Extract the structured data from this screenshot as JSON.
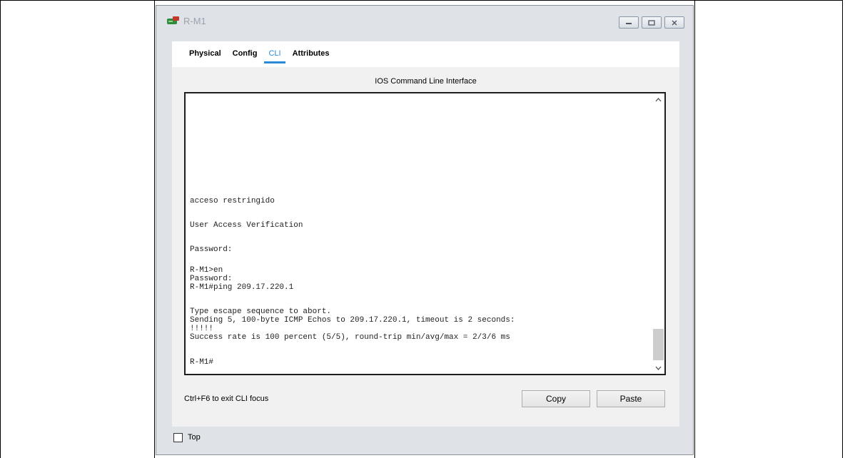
{
  "window": {
    "title": "R-M1",
    "icon": "router-icon",
    "controls": [
      "minimize-icon",
      "maximize-icon",
      "close-icon"
    ]
  },
  "tabs": [
    {
      "label": "Physical",
      "active": false
    },
    {
      "label": "Config",
      "active": false
    },
    {
      "label": "CLI",
      "active": true
    },
    {
      "label": "Attributes",
      "active": false
    }
  ],
  "cli": {
    "header": "IOS Command Line Interface",
    "lines": [
      "acceso restringido",
      "User Access Verification",
      "Password:",
      "R-M1>en",
      "Password:",
      "R-M1#ping 209.17.220.1",
      "Type escape sequence to abort.",
      "Sending 5, 100-byte ICMP Echos to 209.17.220.1, timeout is 2 seconds:",
      "!!!!!",
      "Success rate is 100 percent (5/5), round-trip min/avg/max = 2/3/6 ms",
      "R-M1#"
    ]
  },
  "footer": {
    "hint": "Ctrl+F6 to exit CLI focus",
    "copy_label": "Copy",
    "paste_label": "Paste"
  },
  "top_option": {
    "label": "Top",
    "checked": false
  },
  "colors": {
    "accent": "#2a8ad8",
    "window_bg": "#dfe3e8",
    "panel_bg": "#f1f1f1"
  }
}
